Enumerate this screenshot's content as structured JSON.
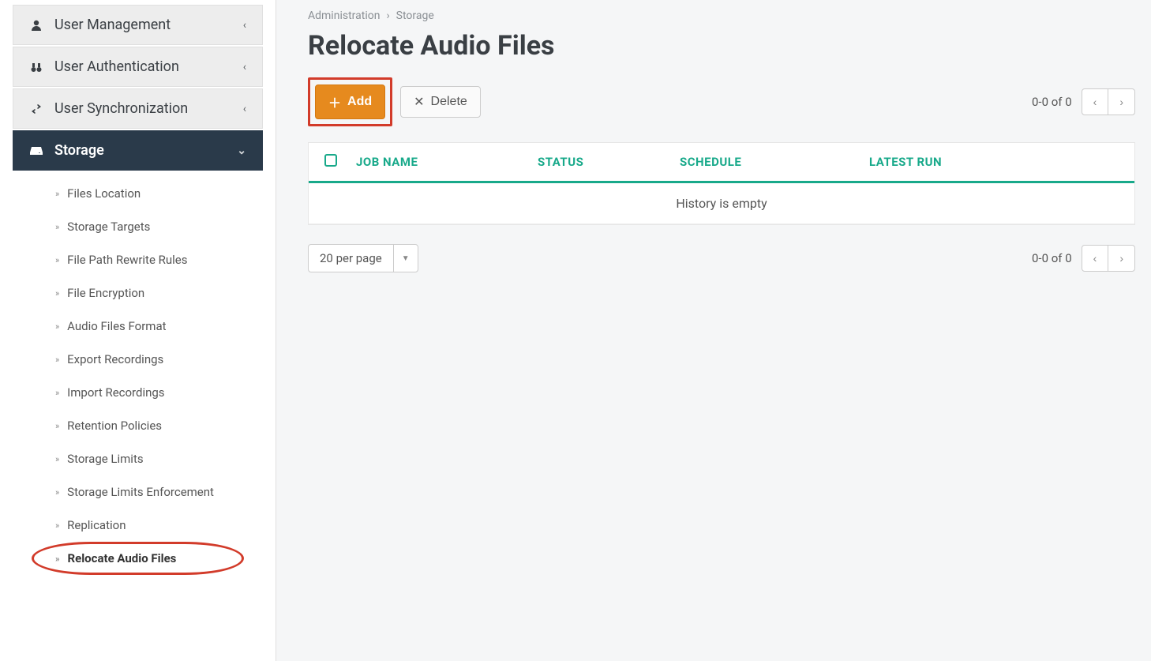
{
  "sidebar": {
    "groups": [
      {
        "id": "user-mgmt",
        "label": "User Management",
        "icon": "user",
        "expanded": false
      },
      {
        "id": "user-auth",
        "label": "User Authentication",
        "icon": "binoculars",
        "expanded": false
      },
      {
        "id": "user-sync",
        "label": "User Synchronization",
        "icon": "exchange",
        "expanded": false
      },
      {
        "id": "storage",
        "label": "Storage",
        "icon": "drive",
        "expanded": true
      }
    ],
    "storage_items": [
      {
        "id": "files-location",
        "label": "Files Location"
      },
      {
        "id": "storage-targets",
        "label": "Storage Targets"
      },
      {
        "id": "file-path-rewrite",
        "label": "File Path Rewrite Rules"
      },
      {
        "id": "file-encryption",
        "label": "File Encryption"
      },
      {
        "id": "audio-format",
        "label": "Audio Files Format"
      },
      {
        "id": "export-recordings",
        "label": "Export Recordings"
      },
      {
        "id": "import-recordings",
        "label": "Import Recordings"
      },
      {
        "id": "retention-policies",
        "label": "Retention Policies"
      },
      {
        "id": "storage-limits",
        "label": "Storage Limits"
      },
      {
        "id": "limits-enforcement",
        "label": "Storage Limits Enforcement"
      },
      {
        "id": "replication",
        "label": "Replication"
      },
      {
        "id": "relocate-audio",
        "label": "Relocate Audio Files",
        "active": true
      }
    ]
  },
  "breadcrumb": {
    "root": "Administration",
    "current": "Storage"
  },
  "page": {
    "title": "Relocate Audio Files"
  },
  "toolbar": {
    "add_label": "Add",
    "delete_label": "Delete"
  },
  "pager": {
    "summary_top": "0-0 of 0",
    "summary_bottom": "0-0 of 0"
  },
  "table": {
    "columns": {
      "job": "JOB NAME",
      "status": "STATUS",
      "schedule": "SCHEDULE",
      "run": "LATEST RUN"
    },
    "empty_label": "History is empty"
  },
  "per_page": {
    "selected": "20 per page"
  }
}
